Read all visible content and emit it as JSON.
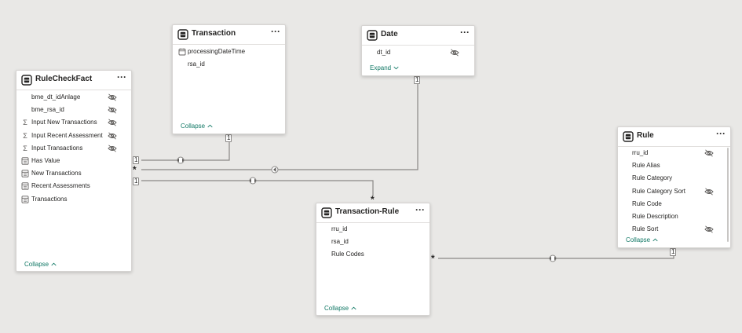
{
  "tables": [
    {
      "name": "RuleCheckFact",
      "more": "···",
      "footer": "Collapse",
      "fields": [
        {
          "name": "bme_dt_idAnlage",
          "icon": "none",
          "hidden": true
        },
        {
          "name": "bme_rsa_id",
          "icon": "none",
          "hidden": true
        },
        {
          "name": "Input New Transactions",
          "icon": "sigma",
          "hidden": true
        },
        {
          "name": "Input Recent Assessment",
          "icon": "sigma",
          "hidden": true
        },
        {
          "name": "Input Transactions",
          "icon": "sigma",
          "hidden": true
        },
        {
          "name": "Has Value",
          "icon": "calc",
          "hidden": false
        },
        {
          "name": "New Transactions",
          "icon": "calc",
          "hidden": false
        },
        {
          "name": "Recent Assessments",
          "icon": "calc",
          "hidden": false
        },
        {
          "name": "Transactions",
          "icon": "calc",
          "hidden": false
        }
      ]
    },
    {
      "name": "Transaction",
      "more": "···",
      "footer": "Collapse",
      "fields": [
        {
          "name": "processingDateTime",
          "icon": "calendar",
          "hidden": false
        },
        {
          "name": "rsa_id",
          "icon": "none",
          "hidden": false
        }
      ]
    },
    {
      "name": "Date",
      "more": "···",
      "footer": "Expand",
      "fields": [
        {
          "name": "dt_id",
          "icon": "none",
          "hidden": true
        }
      ]
    },
    {
      "name": "Rule",
      "more": "···",
      "footer": "Collapse",
      "fields": [
        {
          "name": "rru_id",
          "icon": "none",
          "hidden": true
        },
        {
          "name": "Rule Alias",
          "icon": "none",
          "hidden": false
        },
        {
          "name": "Rule Category",
          "icon": "none",
          "hidden": false
        },
        {
          "name": "Rule Category Sort",
          "icon": "none",
          "hidden": true
        },
        {
          "name": "Rule Code",
          "icon": "none",
          "hidden": false
        },
        {
          "name": "Rule Description",
          "icon": "none",
          "hidden": false
        },
        {
          "name": "Rule Sort",
          "icon": "none",
          "hidden": true
        }
      ]
    },
    {
      "name": "Transaction-Rule",
      "more": "···",
      "footer": "Collapse",
      "fields": [
        {
          "name": "rru_id",
          "icon": "none",
          "hidden": false
        },
        {
          "name": "rsa_id",
          "icon": "none",
          "hidden": false
        },
        {
          "name": "Rule Codes",
          "icon": "none",
          "hidden": false
        }
      ]
    }
  ],
  "relationships": [
    {
      "from_cardinality": "1",
      "to_cardinality": "1",
      "direction": "both"
    },
    {
      "from_cardinality": "*",
      "to_cardinality": "1",
      "direction": "single"
    },
    {
      "from_cardinality": "1",
      "to_cardinality": "*",
      "direction": "both"
    },
    {
      "from_cardinality": "*",
      "to_cardinality": "1",
      "direction": "both"
    }
  ],
  "colors": {
    "canvas": "#e9e8e6",
    "card": "#ffffff",
    "line": "#8a8886",
    "footer_link": "#117865"
  },
  "icons": {
    "table": "table-icon",
    "sigma": "sigma-icon",
    "calc": "calculator-icon",
    "calendar": "calendar-icon",
    "hidden": "eye-hidden-icon",
    "chevron_up": "chevron-up-icon",
    "chevron_down": "chevron-down-icon",
    "more": "more-options-icon"
  }
}
